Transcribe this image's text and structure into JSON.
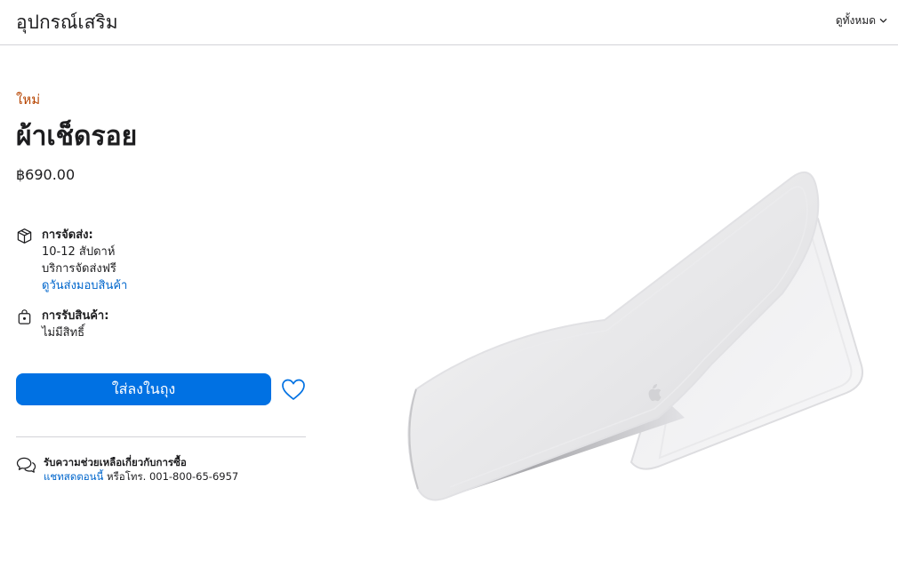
{
  "header": {
    "title": "อุปกรณ์เสริม",
    "view_all": "ดูทั้งหมด",
    "view_all_icon": "chevron-down-icon"
  },
  "product": {
    "badge": "ใหม่",
    "badge_color": "#b64400",
    "name": "ผ้าเช็ดรอย",
    "price": "฿690.00"
  },
  "delivery": {
    "icon": "box-icon",
    "heading": "การจัดส่ง:",
    "line1": "10-12 สัปดาห์",
    "line2": "บริการจัดส่งฟรี",
    "link": "ดูวันส่งมอบสินค้า"
  },
  "pickup": {
    "icon": "store-bag-icon",
    "heading": "การรับสินค้า:",
    "line1": "ไม่มีสิทธิ์"
  },
  "actions": {
    "add_to_bag": "ใส่ลงในถุง",
    "accent_color": "#0071e3",
    "favorite_icon": "heart-icon"
  },
  "help": {
    "icon": "chat-bubbles-icon",
    "heading": "รับความช่วยเหลือเกี่ยวกับการซื้อ",
    "chat_link": "แชทสดตอนนี้",
    "phone_text": " หรือโทร. 001-800-65-6957"
  }
}
